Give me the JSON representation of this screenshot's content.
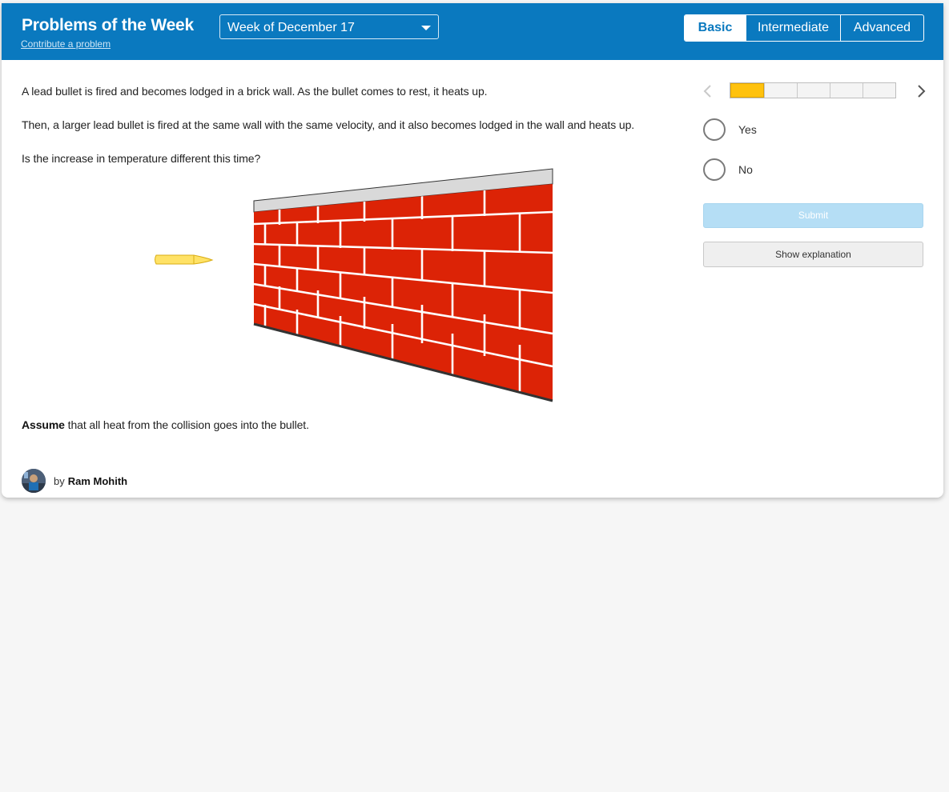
{
  "header": {
    "title": "Problems of the Week",
    "contribute_link": "Contribute a problem",
    "week_select": "Week of December 17",
    "levels": [
      "Basic",
      "Intermediate",
      "Advanced"
    ],
    "active_level": "Basic"
  },
  "problem": {
    "paragraph_1": "A lead bullet is fired and becomes lodged in a brick wall. As the bullet comes to rest, it heats up.",
    "paragraph_2": "Then, a larger lead bullet is fired at the same wall with the same velocity, and it also becomes lodged in the wall and heats up.",
    "question": "Is the increase in temperature different this time?",
    "assume_bold": "Assume",
    "assume_rest": " that all heat from the collision goes into the bullet."
  },
  "author": {
    "by": "by",
    "name": "Ram Mohith"
  },
  "panel": {
    "progress_total": 5,
    "progress_current": 1,
    "choices": [
      "Yes",
      "No"
    ],
    "submit_label": "Submit",
    "explanation_label": "Show explanation"
  },
  "colors": {
    "header_blue": "#0a79bf",
    "brick_red": "#dc2306",
    "bullet_yellow": "#ffe266",
    "progress_yellow": "#ffc20e",
    "submit_disabled": "#b5def5"
  },
  "icons": {
    "prev": "chevron-left-icon",
    "next": "chevron-right-icon",
    "dropdown": "caret-down-icon"
  }
}
